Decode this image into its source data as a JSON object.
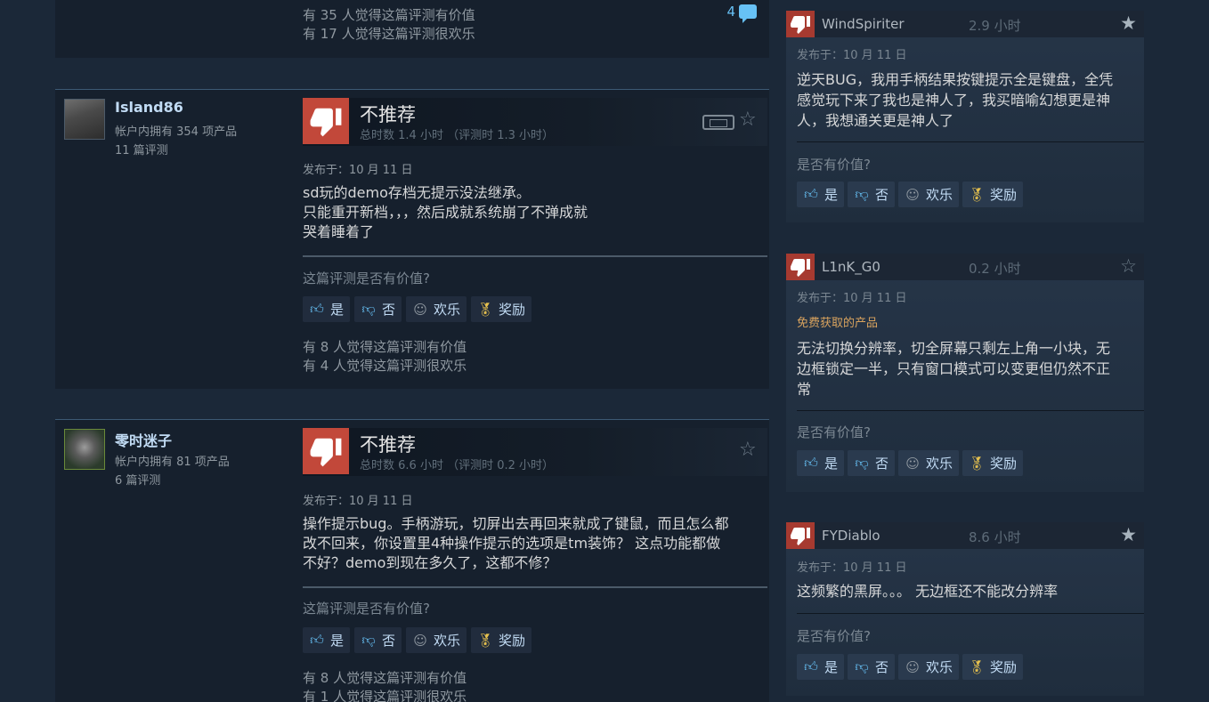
{
  "top_review": {
    "helpful_count": "有 35 人觉得这篇评测有价值",
    "funny_count": "有 17 人觉得这篇评测很欢乐",
    "comment_count": "4"
  },
  "reviews": [
    {
      "author": "Island86",
      "products": "帐户内拥有 354 项产品",
      "review_count": "11 篇评测",
      "verdict": "不推荐",
      "hours": "总时数 1.4 小时 （评测时 1.3 小时）",
      "posted": "发布于：10 月 11 日",
      "body_lines": [
        "sd玩的demo存档无提示没法继承。",
        "只能重开新档，，，然后成就系统崩了不弹成就",
        "哭着睡着了"
      ],
      "helpful_question": "这篇评测是否有价值?",
      "helpful_count": "有 8 人觉得这篇评测有价值",
      "funny_count": "有 4 人觉得这篇评测很欢乐"
    },
    {
      "author": "零时迷子",
      "products": "帐户内拥有 81 项产品",
      "review_count": "6 篇评测",
      "verdict": "不推荐",
      "hours": "总时数 6.6 小时 （评测时 0.2 小时）",
      "posted": "发布于：10 月 11 日",
      "body_lines": [
        "操作提示bug。手柄游玩，切屏出去再回来就成了键鼠，而且怎么都",
        "改不回来，你设置里4种操作提示的选项是tm装饰？ 这点功能都做",
        "不好？demo到现在多久了，这都不修？"
      ],
      "helpful_question": "这篇评测是否有价值?",
      "helpful_count": "有 8 人觉得这篇评测有价值",
      "funny_count": "有 1 人觉得这篇评测很欢乐"
    }
  ],
  "vote_buttons": {
    "yes": "是",
    "no": "否",
    "funny": "欢乐",
    "award": "奖励"
  },
  "side_reviews": [
    {
      "author": "WindSpiriter",
      "hours": "2.9 小时",
      "posted": "发布于：10 月 11 日",
      "free_tag": "",
      "body_lines": [
        "逆天BUG，我用手柄结果按键提示全是键盘，全凭",
        "感觉玩下来了我也是神人了，我买暗喻幻想更是神",
        "人，我想通关更是神人了"
      ],
      "question": "是否有价值?"
    },
    {
      "author": "L1nK_G0",
      "hours": "0.2 小时",
      "posted": "发布于：10 月 11 日",
      "free_tag": "免费获取的产品",
      "body_lines": [
        "无法切换分辨率，切全屏幕只剩左上角一小块，无",
        "边框锁定一半，只有窗口模式可以变更但仍然不正",
        "常"
      ],
      "question": "是否有价值?"
    },
    {
      "author": "FYDiablo",
      "hours": "8.6 小时",
      "posted": "发布于：10 月 11 日",
      "free_tag": "",
      "body_lines": [
        "这频繁的黑屏。。。 无边框还不能改分辨率"
      ],
      "question": "是否有价值?"
    }
  ],
  "colors": {
    "thumb_down": "#c2483a",
    "link": "#67c1f5",
    "award": "#e8c24e",
    "free_tag": "#d9a35e"
  }
}
